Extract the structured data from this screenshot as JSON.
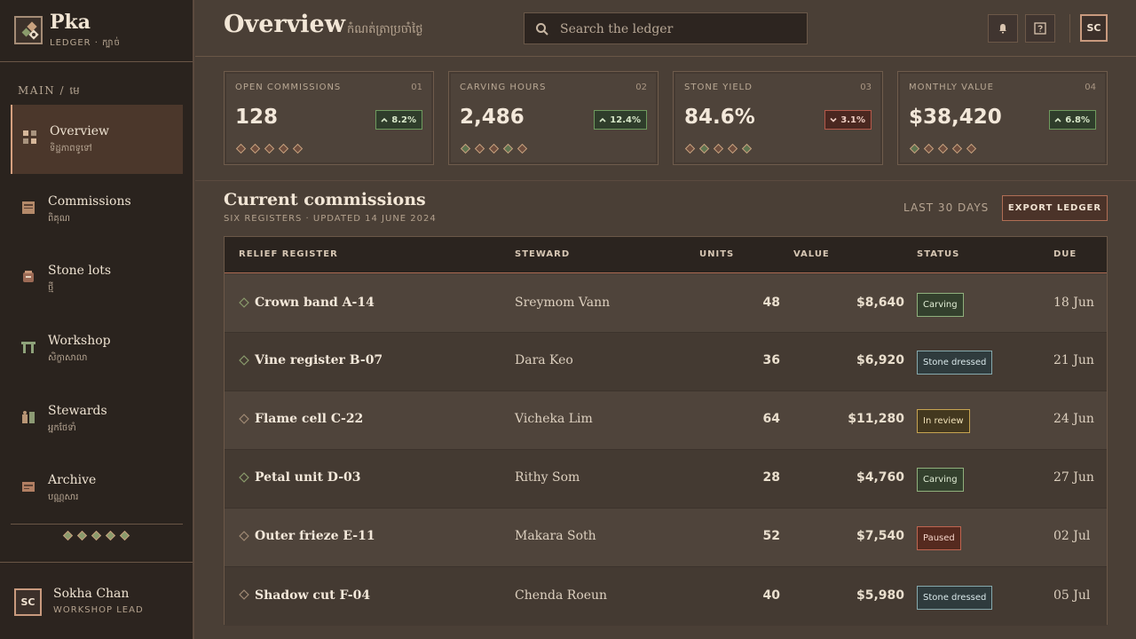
{
  "brand": {
    "name": "Pka",
    "sub": "LEDGER · ក្បាច់"
  },
  "sidebar": {
    "section": "MAIN / មេ",
    "items": [
      {
        "label": "Overview",
        "sub": "ទិដ្ឋភាពទូទៅ",
        "icon": "grid-icon"
      },
      {
        "label": "Commissions",
        "sub": "ពិគុណ",
        "icon": "ledger-book-icon"
      },
      {
        "label": "Stone lots",
        "sub": "ថ្មី",
        "icon": "stone-jar-icon"
      },
      {
        "label": "Workshop",
        "sub": "សិក្ខាសាលា",
        "icon": "gate-icon"
      },
      {
        "label": "Stewards",
        "sub": "អ្នកថែទាំ",
        "icon": "people-icon"
      },
      {
        "label": "Archive",
        "sub": "បណ្ណសារ",
        "icon": "archive-icon"
      }
    ],
    "user": {
      "initials": "SC",
      "name": "Sokha Chan",
      "role": "WORKSHOP LEAD"
    }
  },
  "header": {
    "title": "Overview",
    "subtitle": "កំណត់ត្រាប្រចាំថ្ងៃ",
    "search_placeholder": "Search the ledger",
    "avatar": "SC"
  },
  "kpis": [
    {
      "label": "OPEN COMMISSIONS",
      "num": "01",
      "value": "128",
      "delta": "8.2%",
      "direction": "up"
    },
    {
      "label": "CARVING HOURS",
      "num": "02",
      "value": "2,486",
      "delta": "12.4%",
      "direction": "up"
    },
    {
      "label": "STONE YIELD",
      "num": "03",
      "value": "84.6%",
      "delta": "3.1%",
      "direction": "down"
    },
    {
      "label": "MONTHLY VALUE",
      "num": "04",
      "value": "$38,420",
      "delta": "6.8%",
      "direction": "up"
    }
  ],
  "commissions": {
    "title": "Current commissions",
    "subtitle": "SIX REGISTERS · UPDATED 14 JUNE 2024",
    "range": "LAST 30 DAYS",
    "export": "EXPORT LEDGER",
    "columns": [
      "RELIEF REGISTER",
      "STEWARD",
      "UNITS",
      "VALUE",
      "STATUS",
      "DUE"
    ],
    "rows": [
      {
        "register": "Crown band A-14",
        "steward": "Sreymom Vann",
        "units": "48",
        "value": "$8,640",
        "status": "Carving",
        "due": "18 Jun"
      },
      {
        "register": "Vine register B-07",
        "steward": "Dara Keo",
        "units": "36",
        "value": "$6,920",
        "status": "Stone dressed",
        "due": "21 Jun"
      },
      {
        "register": "Flame cell C-22",
        "steward": "Vicheka Lim",
        "units": "64",
        "value": "$11,280",
        "status": "In review",
        "due": "24 Jun"
      },
      {
        "register": "Petal unit D-03",
        "steward": "Rithy Som",
        "units": "28",
        "value": "$4,760",
        "status": "Carving",
        "due": "27 Jun"
      },
      {
        "register": "Outer frieze E-11",
        "steward": "Makara Soth",
        "units": "52",
        "value": "$7,540",
        "status": "Paused",
        "due": "02 Jul"
      },
      {
        "register": "Shadow cut F-04",
        "steward": "Chenda Roeun",
        "units": "40",
        "value": "$5,980",
        "status": "Stone dressed",
        "due": "05 Jul"
      }
    ]
  },
  "colors": {
    "accent": "#b06e55",
    "status_carving": "#8fb07c",
    "status_dressed": "#86a9ad",
    "status_review": "#c7a451",
    "status_paused": "#bf6550"
  }
}
